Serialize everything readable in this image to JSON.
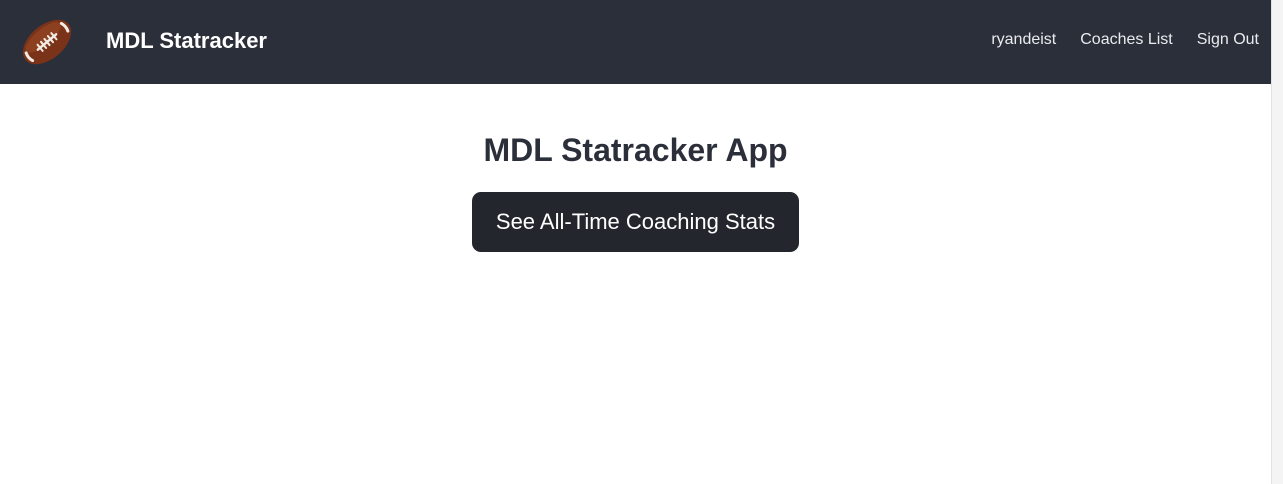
{
  "navbar": {
    "brand_title": "MDL Statracker",
    "logo_icon": "football-icon",
    "links": {
      "username": "ryandeist",
      "coaches_list": "Coaches List",
      "sign_out": "Sign Out"
    }
  },
  "main": {
    "title": "MDL Statracker App",
    "stats_button_label": "See All-Time Coaching Stats"
  },
  "colors": {
    "navbar_bg": "#2b2f3a",
    "button_bg": "#23262d",
    "title_text": "#2b2f3a",
    "football_brown": "#7a3319"
  }
}
